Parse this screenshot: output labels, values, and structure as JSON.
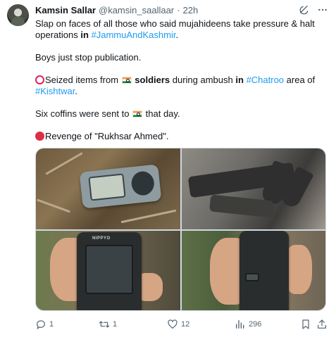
{
  "tweet": {
    "author_name": "Kamsin Sallar",
    "author_handle": "@kamsin_saallaar",
    "separator": "·",
    "time": "22h",
    "line1a": "Slap on faces of all those who said mujahideens take pressure & halt operations ",
    "line1b": "in",
    "line1c": " ",
    "hashtag1": "#JammuAndKashmir",
    "line1d": ".",
    "line2": "Boys just stop publication.",
    "line3a": "Seized items from ",
    "line3b": " ",
    "line3c": "soldiers",
    "line3d": " during ambush ",
    "line3e": "in",
    "line3f": " ",
    "hashtag2": "#Chatroo",
    "line3g": " area of ",
    "hashtag3": "#Kishtwar",
    "line3h": ".",
    "line4a": "Six coffins were sent to ",
    "line4b": " that day.",
    "line5": "Revenge of \"Rukhsar Ahmed\".",
    "device_brand": "NIPPYO"
  },
  "actions": {
    "replies": "1",
    "retweets": "1",
    "likes": "12",
    "views": "296"
  },
  "icons": [
    "grok-icon",
    "more-icon",
    "reply-icon",
    "retweet-icon",
    "like-icon",
    "views-icon",
    "bookmark-icon",
    "share-icon"
  ],
  "colors": {
    "link": "#1d9bf0",
    "text": "#0f1419",
    "muted": "#536471",
    "ring": "#e0245e",
    "red_dot": "#dd2e44"
  }
}
